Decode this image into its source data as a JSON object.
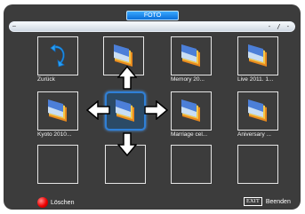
{
  "header": {
    "title": "FOTO"
  },
  "progress": {
    "elapsed": "–",
    "total": "- / -",
    "fraction": 0
  },
  "grid": {
    "items": [
      {
        "label": "Zurück",
        "icon": "back-arrow-icon"
      },
      {
        "label": "",
        "icon": "photo-icon"
      },
      {
        "label": "Memory 20...",
        "icon": "photo-icon"
      },
      {
        "label": "Live 2011. 1...",
        "icon": "photo-icon"
      },
      {
        "label": "Kyoto 2010...",
        "icon": "photo-icon"
      },
      {
        "label": "",
        "icon": "photo-icon"
      },
      {
        "label": "Marriage cel...",
        "icon": "photo-icon"
      },
      {
        "label": "Aniversary ...",
        "icon": "photo-icon"
      },
      {
        "label": "",
        "icon": ""
      },
      {
        "label": "",
        "icon": ""
      },
      {
        "label": "",
        "icon": ""
      },
      {
        "label": "",
        "icon": ""
      }
    ],
    "selected_index": 5
  },
  "footer": {
    "delete_label": "Löschen",
    "delete_color": "#e00000",
    "exit_key": "EXIT",
    "exit_label": "Beenden"
  },
  "colors": {
    "accent": "#1a82f0",
    "background": "#3c3c3c"
  }
}
